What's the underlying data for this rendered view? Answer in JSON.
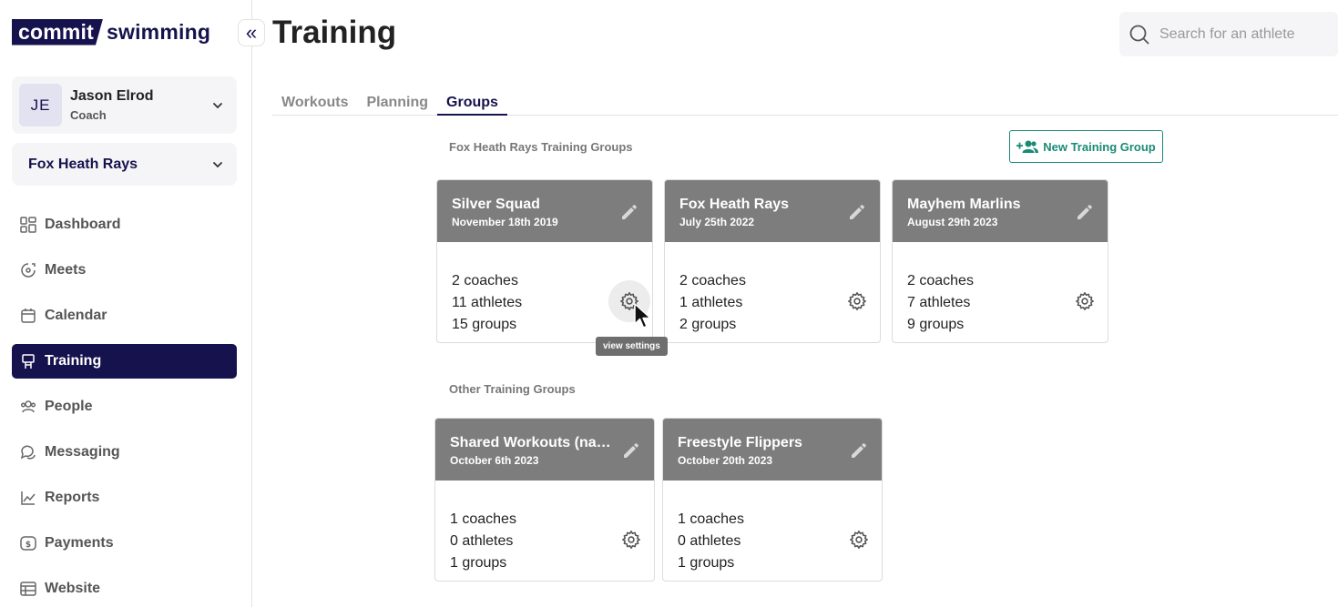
{
  "logo": {
    "part1": "commit",
    "part2": "swimming"
  },
  "user": {
    "initials": "JE",
    "name": "Jason Elrod",
    "role": "Coach"
  },
  "team": {
    "name": "Fox Heath Rays"
  },
  "nav": [
    {
      "label": "Dashboard",
      "icon": "dashboard-icon",
      "active": false
    },
    {
      "label": "Meets",
      "icon": "meets-icon",
      "active": false
    },
    {
      "label": "Calendar",
      "icon": "calendar-icon",
      "active": false
    },
    {
      "label": "Training",
      "icon": "training-icon",
      "active": true
    },
    {
      "label": "People",
      "icon": "people-icon",
      "active": false
    },
    {
      "label": "Messaging",
      "icon": "messaging-icon",
      "active": false
    },
    {
      "label": "Reports",
      "icon": "reports-icon",
      "active": false
    },
    {
      "label": "Payments",
      "icon": "payments-icon",
      "active": false
    },
    {
      "label": "Website",
      "icon": "website-icon",
      "active": false
    }
  ],
  "header": {
    "title": "Training",
    "search_placeholder": "Search for an athlete"
  },
  "tabs": [
    {
      "label": "Workouts",
      "active": false
    },
    {
      "label": "Planning",
      "active": false
    },
    {
      "label": "Groups",
      "active": true
    }
  ],
  "own_groups": {
    "title": "Fox Heath Rays Training Groups",
    "new_button": "New Training Group",
    "cards": [
      {
        "name": "Silver Squad",
        "date": "November 18th 2019",
        "coaches": "2 coaches",
        "athletes": "11 athletes",
        "groups": "15 groups"
      },
      {
        "name": "Fox Heath Rays",
        "date": "July 25th 2022",
        "coaches": "2 coaches",
        "athletes": "1 athletes",
        "groups": "2 groups"
      },
      {
        "name": "Mayhem Marlins",
        "date": "August 29th 2023",
        "coaches": "2 coaches",
        "athletes": "7 athletes",
        "groups": "9 groups"
      }
    ]
  },
  "other_groups": {
    "title": "Other Training Groups",
    "cards": [
      {
        "name": "Shared Workouts (nam…",
        "date": "October 6th 2023",
        "coaches": "1 coaches",
        "athletes": "0 athletes",
        "groups": "1 groups"
      },
      {
        "name": "Freestyle Flippers",
        "date": "October 20th 2023",
        "coaches": "1 coaches",
        "athletes": "0 athletes",
        "groups": "1 groups"
      }
    ]
  },
  "tooltip": "view settings",
  "colors": {
    "brand": "#16124d",
    "accent": "#1a8a77",
    "card_header": "#7d7d7d"
  }
}
